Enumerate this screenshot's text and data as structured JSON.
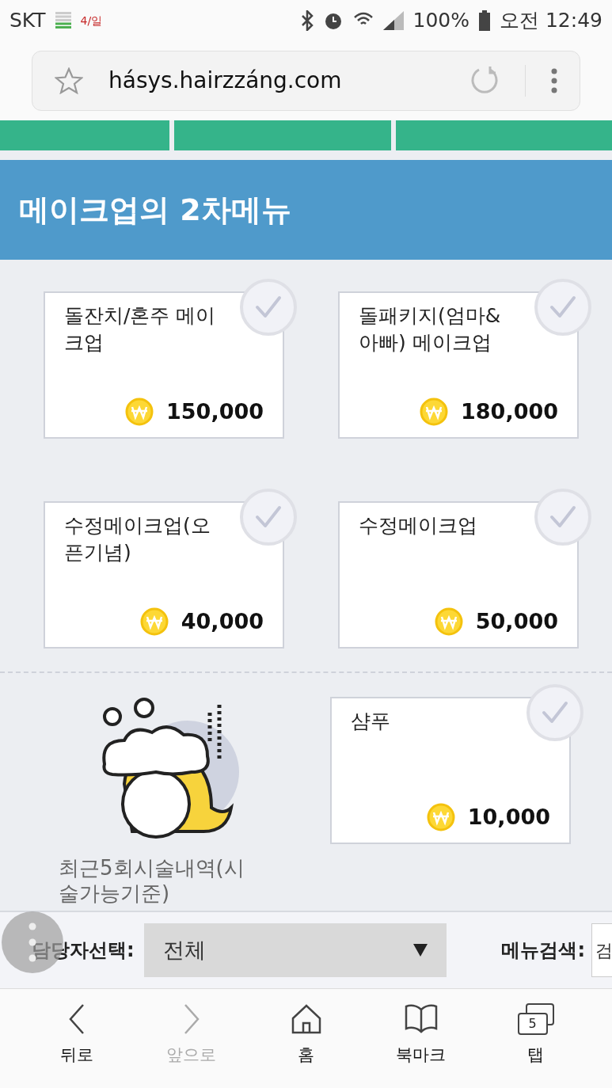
{
  "status_bar": {
    "carrier": "SKT",
    "date_badge": "4/일",
    "battery": "100%",
    "time": "오전 12:49"
  },
  "address_bar": {
    "url": "hásys.hairzzáng.com"
  },
  "header": {
    "title": "메이크업의 2차메뉴"
  },
  "menu_items": [
    {
      "name": "돌잔치/혼주 메이크업",
      "price": "150,000",
      "selected": false
    },
    {
      "name": "돌패키지(엄마&아빠) 메이크업",
      "price": "180,000",
      "selected": false
    },
    {
      "name": "수정메이크업(오픈기념)",
      "price": "40,000",
      "selected": false
    },
    {
      "name": "수정메이크업",
      "price": "50,000",
      "selected": false
    }
  ],
  "history": {
    "caption": "최근5회시술내역(시술가능기준)"
  },
  "extra_items": [
    {
      "name": "샴푸",
      "price": "10,000",
      "selected": false
    }
  ],
  "filter_bar": {
    "staff_label": "담당자선택:",
    "staff_value": "전체",
    "search_label": "메뉴검색:",
    "search_value": "검"
  },
  "bottom_nav": [
    {
      "label": "뒤로",
      "kind": "back",
      "disabled": false
    },
    {
      "label": "앞으로",
      "kind": "forward",
      "disabled": true
    },
    {
      "label": "홈",
      "kind": "home",
      "disabled": false
    },
    {
      "label": "북마크",
      "kind": "bookmark",
      "disabled": false
    },
    {
      "label": "탭",
      "kind": "tabs",
      "disabled": false,
      "count": "5"
    }
  ]
}
